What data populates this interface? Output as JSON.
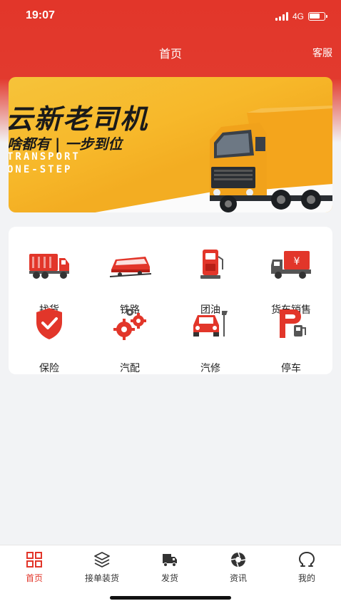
{
  "status_bar": {
    "time": "19:07",
    "network": "4G"
  },
  "nav": {
    "title": "首页",
    "service": "客服"
  },
  "banner": {
    "title": "云新老司机",
    "subtitle": "啥都有 | 一步到位",
    "en_line1": "TRANSPORT",
    "en_line2": "ONE-STEP"
  },
  "features": [
    {
      "label": "找货",
      "icon": "cargo-truck-icon"
    },
    {
      "label": "铁路",
      "icon": "train-icon"
    },
    {
      "label": "团油",
      "icon": "fuel-pump-icon"
    },
    {
      "label": "货车销售",
      "icon": "truck-sale-icon"
    },
    {
      "label": "保险",
      "icon": "shield-check-icon"
    },
    {
      "label": "汽配",
      "icon": "gears-icon"
    },
    {
      "label": "汽修",
      "icon": "car-wrench-icon"
    },
    {
      "label": "停车",
      "icon": "parking-icon"
    }
  ],
  "tabs": [
    {
      "label": "首页",
      "icon": "home-grid-icon",
      "active": true
    },
    {
      "label": "接单装货",
      "icon": "layers-icon",
      "active": false
    },
    {
      "label": "发货",
      "icon": "truck-icon",
      "active": false
    },
    {
      "label": "资讯",
      "icon": "aperture-icon",
      "active": false
    },
    {
      "label": "我的",
      "icon": "user-icon",
      "active": false
    }
  ],
  "colors": {
    "brand_red": "#e2362a",
    "banner_yellow": "#f6c33a",
    "page_bg": "#f2f3f5"
  }
}
